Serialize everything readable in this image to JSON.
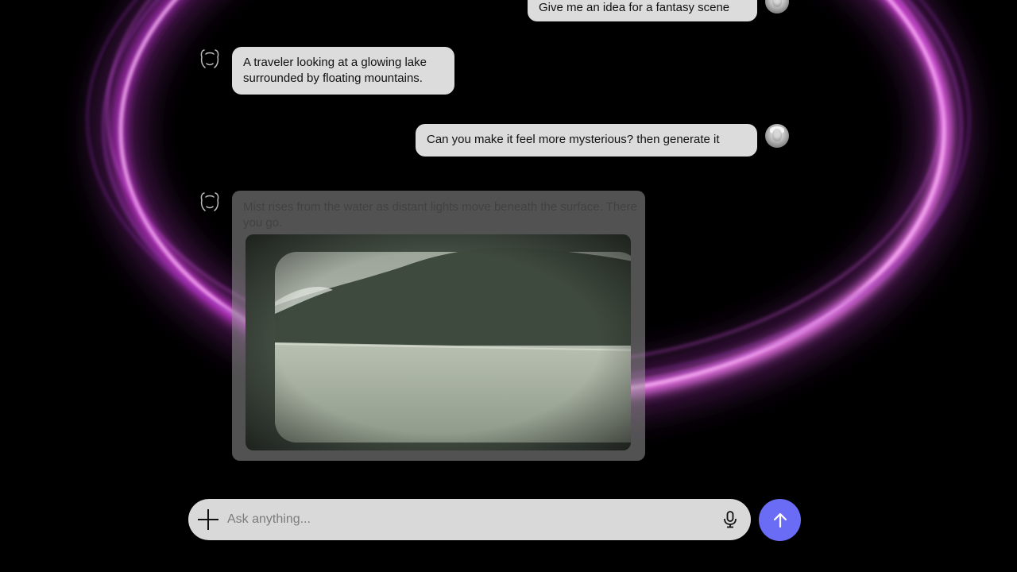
{
  "conversation": {
    "messages": [
      {
        "role": "user",
        "text": "Give me an idea for a fantasy scene"
      },
      {
        "role": "assistant",
        "text": "A traveler looking at a glowing lake surrounded by floating mountains."
      },
      {
        "role": "user",
        "text": "Can you make it feel more mysterious? then generate it"
      },
      {
        "role": "assistant",
        "text": "Mist rises from the water as distant lights move beneath the surface. There you go."
      }
    ]
  },
  "composer": {
    "placeholder": "Ask anything...",
    "value": ""
  },
  "icons": {
    "attach": "plus-icon",
    "mic": "microphone-icon",
    "send": "arrow-up-icon",
    "assistant": "assistant-logo-icon"
  },
  "colors": {
    "background": "#000000",
    "bubble": "#dcdcdc",
    "send_button": "#6b6cf6",
    "glow": "#ff66f0"
  }
}
